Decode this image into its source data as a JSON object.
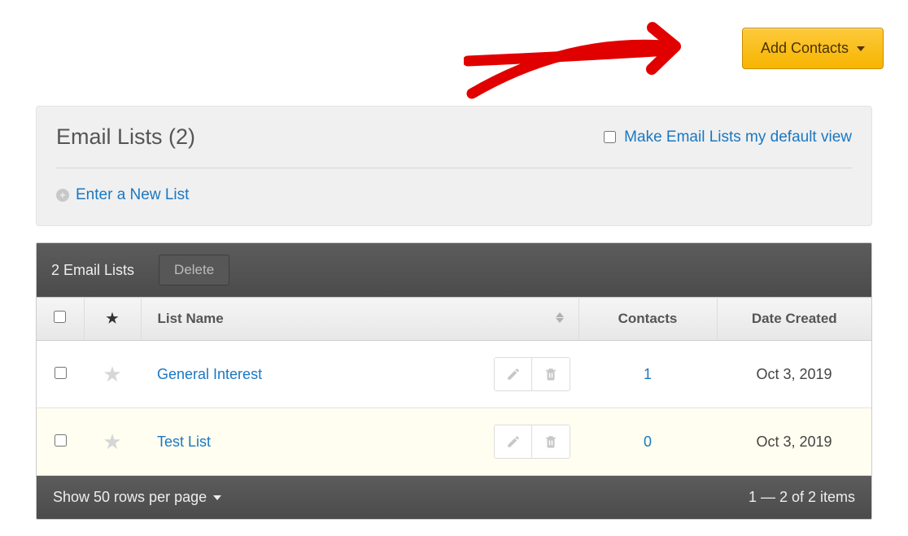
{
  "header": {
    "add_contacts_label": "Add Contacts"
  },
  "panel": {
    "title": "Email Lists (2)",
    "default_view_label": "Make Email Lists my default view",
    "new_list_label": "Enter a New List"
  },
  "toolbar": {
    "count_label": "2 Email Lists",
    "delete_label": "Delete"
  },
  "columns": {
    "list_name": "List Name",
    "contacts": "Contacts",
    "date_created": "Date Created"
  },
  "rows": [
    {
      "name": "General Interest",
      "contacts": "1",
      "date": "Oct 3, 2019"
    },
    {
      "name": "Test List",
      "contacts": "0",
      "date": "Oct 3, 2019"
    }
  ],
  "footer": {
    "rows_per_page": "Show 50 rows per page",
    "pagination": "1 — 2 of 2 items"
  }
}
